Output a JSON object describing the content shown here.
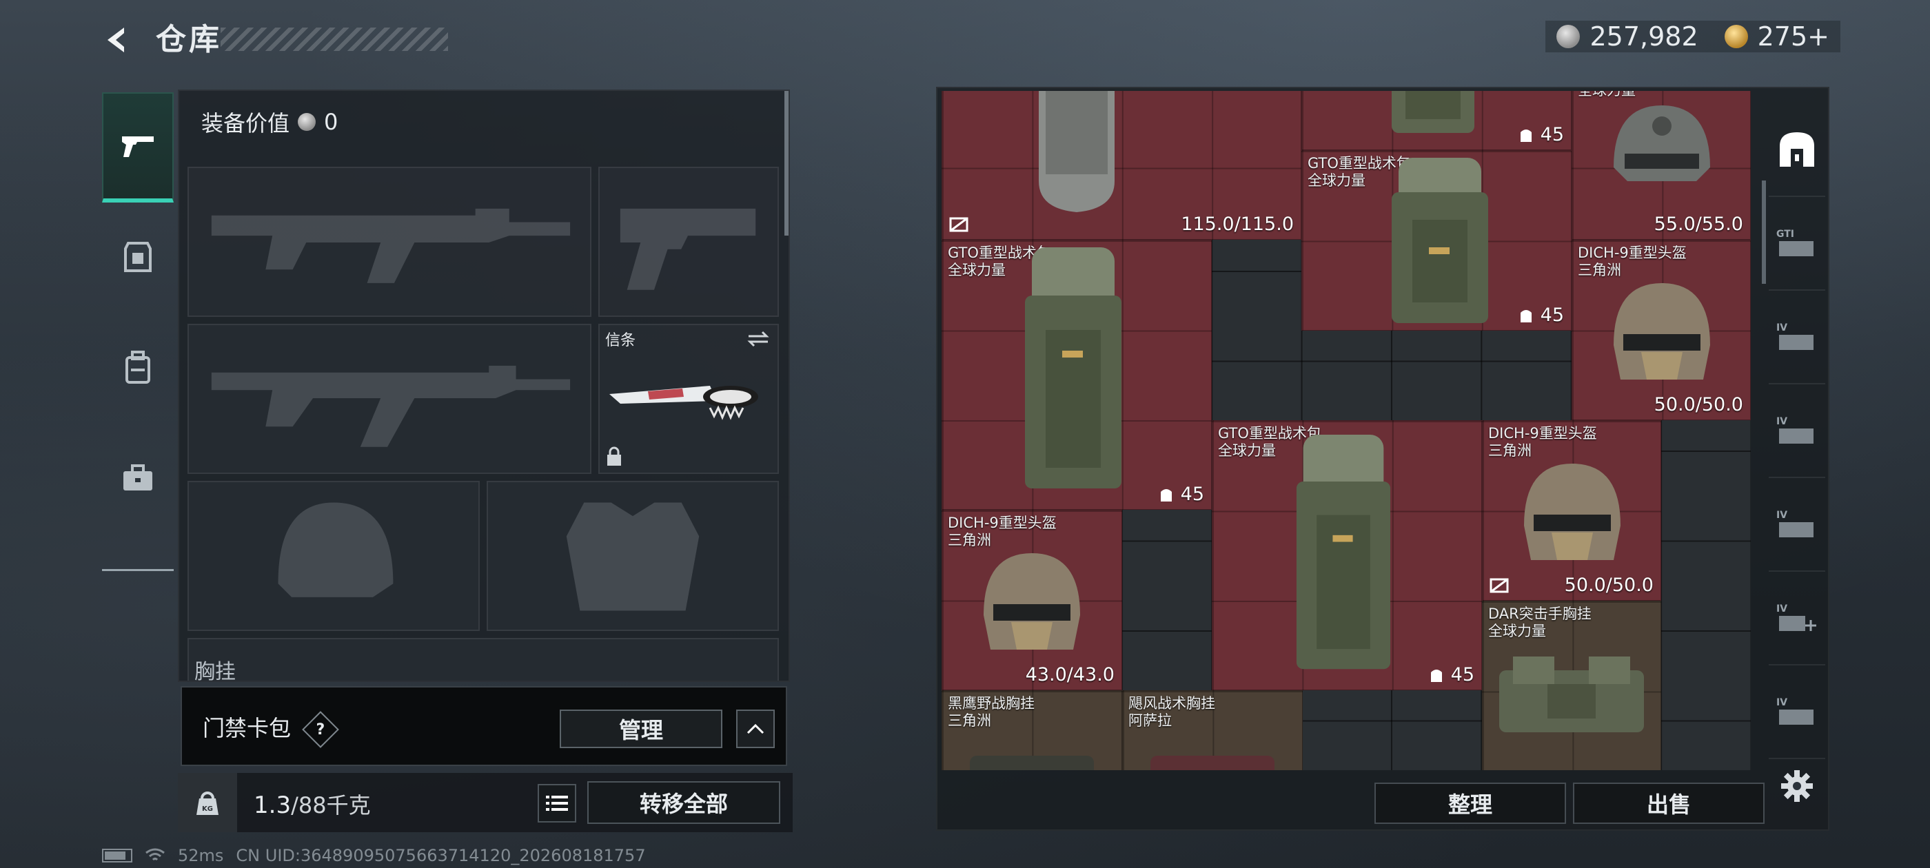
{
  "header": {
    "title": "仓库",
    "currency": {
      "silver": "257,982",
      "gold": "275+"
    }
  },
  "sidebar": {
    "items": [
      {
        "name": "weapons",
        "icon": "pistol-icon",
        "active": true
      },
      {
        "name": "armor",
        "icon": "armor-icon",
        "active": false
      },
      {
        "name": "backpack",
        "icon": "backpack-icon",
        "active": false
      },
      {
        "name": "kit",
        "icon": "briefcase-icon",
        "active": false
      }
    ]
  },
  "loadout": {
    "equip_value_label": "装备价值",
    "equip_value": "0",
    "melee_label": "信条",
    "chest_label": "胸挂"
  },
  "card_bag": {
    "label": "门禁卡包",
    "help": "?",
    "manage_label": "管理"
  },
  "weight": {
    "current": "1.3",
    "max": "/88千克",
    "transfer_label": "转移全部"
  },
  "status": {
    "ping": "52ms",
    "uid": "CN UID:364890950756637141​20_202608181757"
  },
  "inventory": {
    "items": [
      {
        "name": "",
        "brand": "",
        "stat": "115.0/115.0",
        "nodur": true
      },
      {
        "name": "",
        "brand": "",
        "stat": "45",
        "nodur": false
      },
      {
        "name": "",
        "brand": "全球力量",
        "stat": "55.0/55.0",
        "nodur": false
      },
      {
        "name": "GTO重型战术包",
        "brand": "全球力量",
        "stat": "45",
        "nodur": false
      },
      {
        "name": "GTO重型战术包",
        "brand": "全球力量",
        "stat": "45",
        "nodur": false
      },
      {
        "name": "DICH-9重型头盔",
        "brand": "三角洲",
        "stat": "50.0/50.0",
        "nodur": false
      },
      {
        "name": "GTO重型战术包",
        "brand": "全球力量",
        "stat": "45",
        "nodur": false
      },
      {
        "name": "DICH-9重型头盔",
        "brand": "三角洲",
        "stat": "50.0/50.0",
        "nodur": true
      },
      {
        "name": "DICH-9重型头盔",
        "brand": "三角洲",
        "stat": "43.0/43.0",
        "nodur": false
      },
      {
        "name": "DAR突击手胸挂",
        "brand": "全球力量",
        "stat": "",
        "nodur": false
      },
      {
        "name": "黑鹰野战胸挂",
        "brand": "三角洲",
        "stat": "",
        "nodur": false
      },
      {
        "name": "飓风战术胸挂",
        "brand": "阿萨拉",
        "stat": "",
        "nodur": false
      }
    ],
    "sort_label": "整理",
    "sell_label": "出售"
  },
  "right_tools": [
    "safe-icon",
    "gti-icon",
    "tier4-icon-1",
    "tier4-icon-2",
    "tier4-icon-3",
    "tier4-add-icon",
    "tier4-icon-4"
  ],
  "colors": {
    "accent": "#3ad1b6",
    "item_red": "#6b2f36",
    "item_brown": "#4b4035"
  }
}
